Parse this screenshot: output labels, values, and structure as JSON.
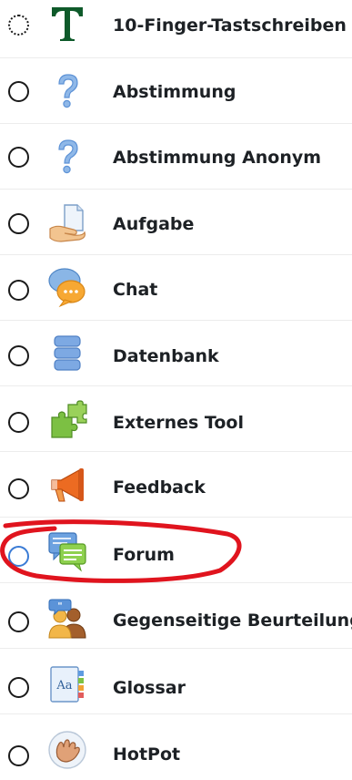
{
  "activities": [
    {
      "label": "10-Finger-Tastschreiben",
      "icon": "typewriter-t-icon"
    },
    {
      "label": "Abstimmung",
      "icon": "question-mark-icon"
    },
    {
      "label": "Abstimmung Anonym",
      "icon": "question-mark-icon"
    },
    {
      "label": "Aufgabe",
      "icon": "assignment-hand-icon"
    },
    {
      "label": "Chat",
      "icon": "chat-bubbles-icon"
    },
    {
      "label": "Datenbank",
      "icon": "database-icon"
    },
    {
      "label": "Externes Tool",
      "icon": "puzzle-icon"
    },
    {
      "label": "Feedback",
      "icon": "megaphone-icon"
    },
    {
      "label": "Forum",
      "icon": "forum-bubbles-icon"
    },
    {
      "label": "Gegenseitige Beurteilung",
      "icon": "workshop-people-icon"
    },
    {
      "label": "Glossar",
      "icon": "glossary-book-icon"
    },
    {
      "label": "HotPot",
      "icon": "hotpot-hand-icon"
    }
  ],
  "selected_activity": "Forum",
  "colors": {
    "label": "#1d2125",
    "radio_border": "#1a1a1a",
    "radio_selected": "#3a7bd5",
    "annotation": "#e0141e"
  }
}
